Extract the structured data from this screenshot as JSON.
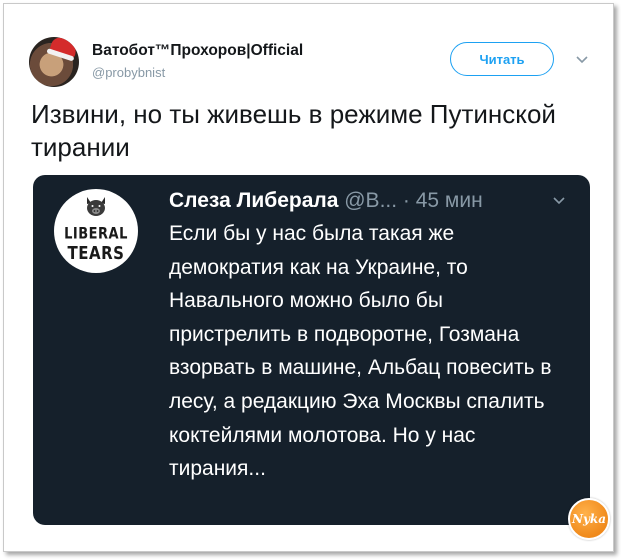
{
  "tweet": {
    "author_name": "Ватобот™Прохоров|Official",
    "author_handle": "@probybnist",
    "follow_label": "Читать",
    "text": "Извини, но ты живешь в режиме Путинской тирании"
  },
  "embedded_tweet": {
    "logo_line1": "LIBERAL",
    "logo_line2": "TEARS",
    "author_name": "Слеза Либерала",
    "meta": " @В... · 45 мин",
    "text": "Если бы у нас была такая же демократия как на Украине, то Навального можно было бы пристрелить в подворотне, Гозмана взорвать в машине, Альбац повесить в лесу, а редакцию Эха Москвы спалить коктейлями молотова. Но у нас тирания..."
  },
  "watermark": {
    "text": "Nyka"
  },
  "colors": {
    "accent": "#1da1f2",
    "embed_background": "#15202b",
    "muted_text": "#8899a6"
  }
}
